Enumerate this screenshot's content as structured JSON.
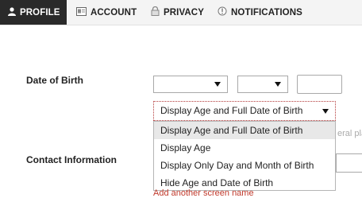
{
  "tabs": [
    {
      "label": "PROFILE",
      "icon": "person-icon",
      "active": true
    },
    {
      "label": "ACCOUNT",
      "icon": "id-card-icon",
      "active": false
    },
    {
      "label": "PRIVACY",
      "icon": "lock-icon",
      "active": false
    },
    {
      "label": "NOTIFICATIONS",
      "icon": "alert-icon",
      "active": false
    }
  ],
  "dob": {
    "label": "Date of Birth",
    "month_value": "",
    "day_value": "",
    "year_value": "",
    "display_selected": "Display Age and Full Date of Birth",
    "display_options": [
      "Display Age and Full Date of Birth",
      "Display Age",
      "Display Only Day and Month of Birth",
      "Hide Age and Date of Birth"
    ]
  },
  "hint_text": "eral plac",
  "contact": {
    "label": "Contact Information"
  },
  "add_link_text": "Add another screen name",
  "colors": {
    "active_tab_bg": "#2a2a2a",
    "link_red": "#c0392b",
    "highlight": "#e8e8e8"
  }
}
